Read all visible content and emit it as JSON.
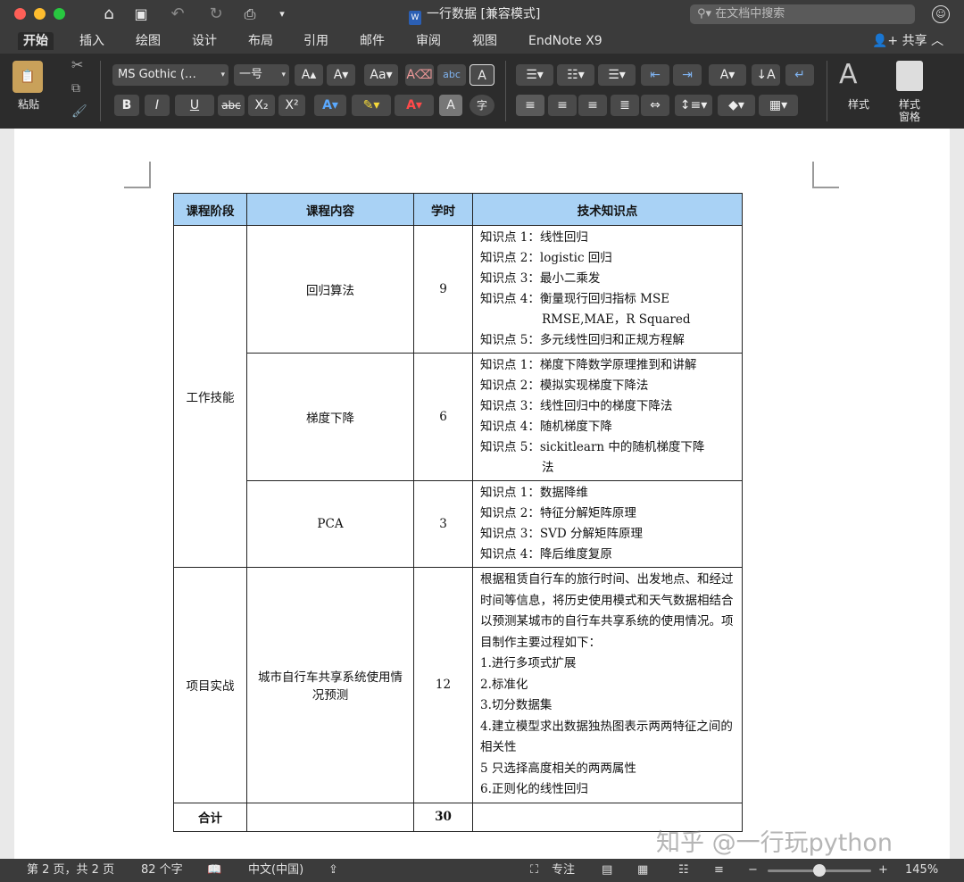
{
  "window": {
    "title": "一行数据 [兼容模式]",
    "search_placeholder": "在文档中搜索"
  },
  "tabs": [
    "开始",
    "插入",
    "绘图",
    "设计",
    "布局",
    "引用",
    "邮件",
    "审阅",
    "视图",
    "EndNote X9"
  ],
  "share_label": "共享",
  "ribbon": {
    "paste_label": "粘贴",
    "font_name": "MS Gothic (…",
    "font_size": "一号",
    "bold": "B",
    "italic": "I",
    "underline": "U",
    "strike": "abc",
    "subscript": "X₂",
    "superscript": "X²",
    "styles_label": "样式",
    "styles_pane_label_1": "样式",
    "styles_pane_label_2": "窗格"
  },
  "table": {
    "headers": [
      "课程阶段",
      "课程内容",
      "学时",
      "技术知识点"
    ],
    "stage1": "工作技能",
    "stage2": "项目实战",
    "rows": [
      {
        "content": "回归算法",
        "hours": "9",
        "points": [
          "知识点 1：线性回归",
          "知识点 2：logistic 回归",
          "知识点 3：最小二乘发",
          "知识点 4：衡量现行回归指标 MSE",
          "RMSE,MAE，R Squared",
          "知识点 5：多元线性回归和正规方程解"
        ]
      },
      {
        "content": "梯度下降",
        "hours": "6",
        "points": [
          "知识点 1：梯度下降数学原理推到和讲解",
          "知识点 2：模拟实现梯度下降法",
          "知识点 3：线性回归中的梯度下降法",
          "知识点 4：随机梯度下降",
          "知识点 5：sickitlearn 中的随机梯度下降",
          "法"
        ]
      },
      {
        "content": "PCA",
        "hours": "3",
        "points": [
          "知识点 1：数据降维",
          "知识点 2：特征分解矩阵原理",
          "知识点 3：SVD 分解矩阵原理",
          "知识点 4：降后维度复原"
        ]
      },
      {
        "content": "城市自行车共享系统使用情况预测",
        "hours": "12",
        "description": "根据租赁自行车的旅行时间、出发地点、和经过时间等信息，将历史使用模式和天气数据相结合以预测某城市的自行车共享系统的使用情况。项目制作主要过程如下：",
        "steps": [
          "1.进行多项式扩展",
          "2.标准化",
          "3.切分数据集",
          "4.建立模型求出数据独热图表示两两特征之间的相关性",
          "5 只选择高度相关的两两属性",
          "6.正则化的线性回归"
        ]
      }
    ],
    "total_label": "合计",
    "total_hours": "30"
  },
  "watermark": "知乎 @一行玩python",
  "status": {
    "page": "第 2 页，共 2 页",
    "words": "82 个字",
    "language": "中文(中国)",
    "focus": "专注",
    "zoom": "145%",
    "zoom_fraction": 0.5
  }
}
